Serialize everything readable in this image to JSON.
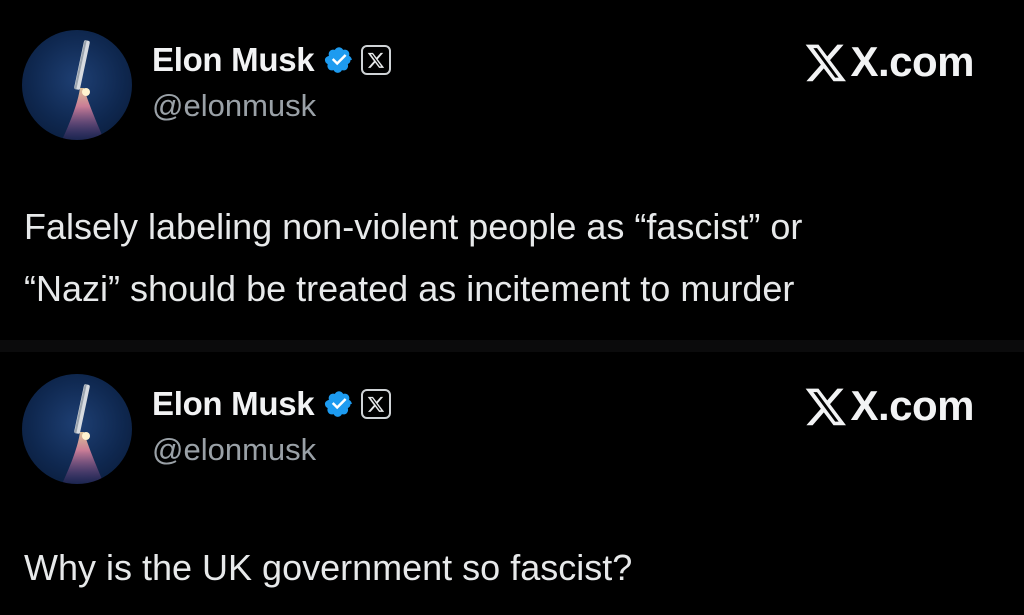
{
  "tweets": [
    {
      "author": {
        "display_name": "Elon Musk",
        "handle": "@elonmusk",
        "verified_icon": "verified-badge-icon",
        "affiliate_icon": "x-logo-icon"
      },
      "brand": "X.com",
      "text_line_1": "Falsely labeling non-violent people as “fascist” or",
      "text_line_2": "“Nazi” should be treated as incitement to murder"
    },
    {
      "author": {
        "display_name": "Elon Musk",
        "handle": "@elonmusk",
        "verified_icon": "verified-badge-icon",
        "affiliate_icon": "x-logo-icon"
      },
      "brand": "X.com",
      "text_line_1": "Why is the UK government so fascist?"
    }
  ],
  "colors": {
    "background": "#000000",
    "text": "#e7e9ea",
    "handle": "#9aa1a7",
    "verified": "#1d9bf0"
  }
}
